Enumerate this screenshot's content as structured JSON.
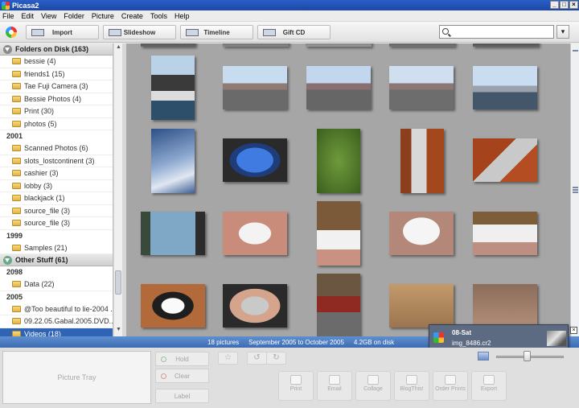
{
  "window": {
    "title": "Picasa2",
    "buttons": [
      "_",
      "□",
      "×"
    ]
  },
  "menu": [
    "File",
    "Edit",
    "View",
    "Folder",
    "Picture",
    "Create",
    "Tools",
    "Help"
  ],
  "toolbar": {
    "buttons": [
      "Import",
      "Slideshow",
      "Timeline",
      "Gift CD"
    ],
    "search_placeholder": "",
    "search_options": "▾"
  },
  "sidebar": {
    "sections": [
      {
        "title": "Folders on Disk (163)",
        "groups": [
          {
            "year": "",
            "items": [
              "bessie (4)",
              "friends1 (15)",
              "Tae Fuji Camera (3)",
              "Bessie Photos (4)",
              "Print (30)",
              "photos (5)"
            ]
          },
          {
            "year": "2001",
            "items": [
              "Scanned Photos (6)",
              "slots_lostcontinent (3)",
              "cashier (3)",
              "lobby (3)",
              "blackjack (1)",
              "source_file (3)",
              "source_file (3)"
            ]
          },
          {
            "year": "1999",
            "items": [
              "Samples (21)"
            ]
          }
        ]
      },
      {
        "title": "Other Stuff (61)",
        "groups": [
          {
            "year": "2098",
            "items": [
              "Data (22)"
            ]
          },
          {
            "year": "2005",
            "items": [
              "@Too beautiful to lie-2004 ...",
              "09.22.05.Gabal.2005.DVD..."
            ]
          }
        ]
      }
    ],
    "selected_item": "Videos (18)"
  },
  "status": {
    "count": "18 pictures",
    "range": "September 2005 to October 2005",
    "size": "4.2GB on disk"
  },
  "popup": {
    "date": "08-Sat",
    "file": "img_8486.cr2",
    "close": "×"
  },
  "tray": {
    "label": "Picture Tray",
    "buttons": [
      "Hold",
      "Clear",
      "Label"
    ],
    "mini": [
      "☆",
      "↺",
      "↻"
    ]
  },
  "actions": [
    {
      "label": "Print"
    },
    {
      "label": "Email"
    },
    {
      "label": "Collage"
    },
    {
      "label": "BlogThis!"
    },
    {
      "label": "Order Prints"
    },
    {
      "label": "Export"
    }
  ],
  "zoom_level": 0.45,
  "colors": {
    "status_bar": "#4a7cc2",
    "selection": "#2f63b3",
    "lighttable": "#a6a6a6"
  }
}
